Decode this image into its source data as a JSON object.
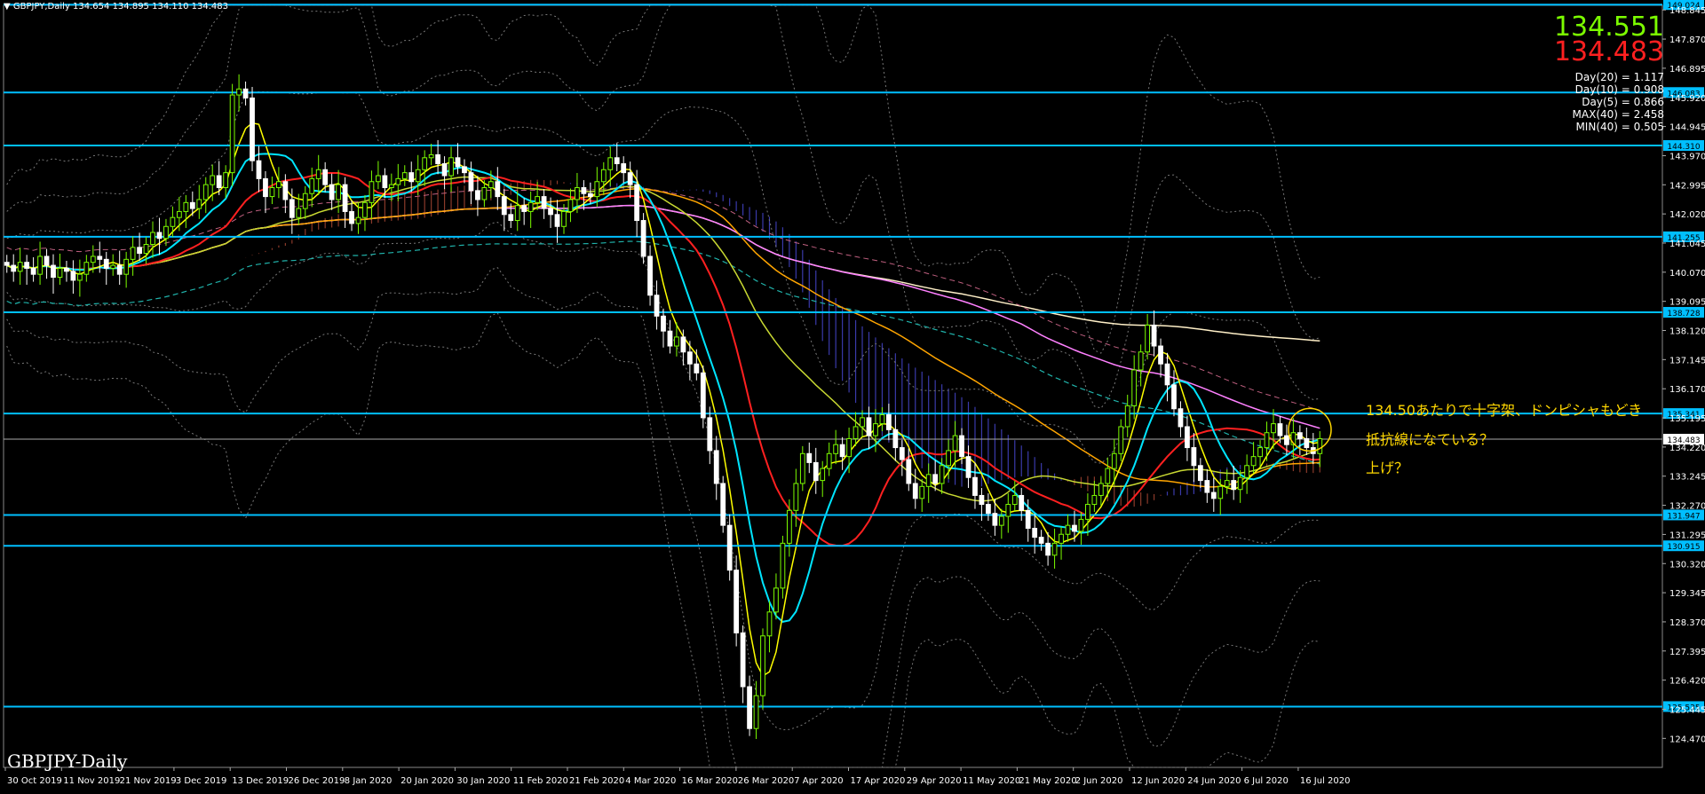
{
  "header": {
    "symbol_line": "▼ GBPJPY,Daily  134.654 134.895 134.110 134.483",
    "bottom_label": "GBPJPY-Daily"
  },
  "hud": {
    "bid": "134.551",
    "ask": "134.483",
    "stats": [
      "Day(20) = 1.117",
      "Day(10) = 0.908",
      "Day(5) = 0.866",
      "MAX(40) = 2.458",
      "MIN(40) = 0.505"
    ]
  },
  "annotations": {
    "line1": "134.50あたりで十字架、ドンピシャもどき",
    "line2": "抵抗線になている？",
    "line3": "上げ？"
  },
  "colors": {
    "background": "#000000",
    "bull_candle": "#7CFC00",
    "bear_candle": "#FFFFFF",
    "hline": "#00BFFF",
    "ma_fast": "#FFFF00",
    "ma_mid": "#00E5FF",
    "ma_red": "#FF2020",
    "ma_slow_yellow": "#C8D832",
    "ma_orange": "#FFA500",
    "ma_pink": "#FF80FF",
    "ma_white": "#FFF0C8",
    "ma_teal": "#20B2AA",
    "cloud_bull": "#8B3A2A",
    "cloud_bear": "#3A3AAA",
    "annotation": "#FFD700"
  },
  "chart_data": {
    "type": "candlestick",
    "symbol": "GBPJPY",
    "timeframe": "Daily",
    "ylim": [
      123.5,
      149.0
    ],
    "y_ticks": [
      "148.845",
      "147.870",
      "146.895",
      "145.920",
      "144.945",
      "143.970",
      "142.995",
      "142.020",
      "141.045",
      "140.070",
      "139.095",
      "138.120",
      "137.145",
      "136.170",
      "135.195",
      "134.220",
      "133.245",
      "132.270",
      "131.295",
      "130.320",
      "129.345",
      "128.370",
      "127.395",
      "126.420",
      "125.445",
      "124.470"
    ],
    "x_ticks": [
      "30 Oct 2019",
      "11 Nov 2019",
      "21 Nov 2019",
      "3 Dec 2019",
      "13 Dec 2019",
      "26 Dec 2019",
      "8 Jan 2020",
      "20 Jan 2020",
      "30 Jan 2020",
      "11 Feb 2020",
      "21 Feb 2020",
      "4 Mar 2020",
      "16 Mar 2020",
      "26 Mar 2020",
      "7 Apr 2020",
      "17 Apr 2020",
      "29 Apr 2020",
      "11 May 2020",
      "21 May 2020",
      "2 Jun 2020",
      "12 Jun 2020",
      "24 Jun 2020",
      "6 Jul 2020",
      "16 Jul 2020"
    ],
    "current_price": 134.483,
    "horizontal_levels": [
      {
        "price": 149.024,
        "label": "149.024"
      },
      {
        "price": 146.083,
        "label": "146.083"
      },
      {
        "price": 144.31,
        "label": "144.310"
      },
      {
        "price": 141.255,
        "label": "141.255"
      },
      {
        "price": 138.728,
        "label": "138.728"
      },
      {
        "price": 135.341,
        "label": "135.341"
      },
      {
        "price": 131.947,
        "label": "131.947"
      },
      {
        "price": 130.915,
        "label": "130.915"
      },
      {
        "price": 125.535,
        "label": "125.535"
      }
    ],
    "close_series": [
      140.3,
      140.1,
      140.4,
      140.2,
      140.0,
      140.6,
      140.3,
      139.9,
      140.2,
      140.1,
      139.8,
      140.0,
      140.4,
      140.6,
      140.5,
      140.2,
      140.3,
      140.0,
      140.5,
      140.9,
      140.7,
      141.0,
      141.4,
      141.2,
      141.6,
      141.9,
      142.1,
      142.4,
      142.2,
      142.5,
      143.0,
      143.3,
      142.9,
      143.4,
      146.0,
      146.2,
      145.9,
      143.8,
      143.2,
      142.6,
      142.9,
      143.1,
      142.5,
      141.9,
      142.2,
      142.7,
      143.2,
      143.5,
      143.0,
      142.5,
      143.0,
      142.1,
      141.7,
      141.9,
      142.4,
      143.1,
      143.3,
      142.9,
      143.0,
      143.2,
      143.4,
      143.1,
      143.5,
      143.9,
      144.0,
      143.7,
      143.3,
      143.9,
      143.6,
      143.4,
      142.8,
      142.5,
      142.9,
      143.1,
      142.6,
      142.0,
      141.8,
      142.3,
      142.1,
      142.4,
      142.6,
      142.2,
      142.0,
      141.6,
      142.1,
      142.5,
      142.9,
      142.7,
      142.6,
      143.1,
      143.5,
      143.9,
      143.7,
      143.4,
      143.0,
      141.8,
      140.6,
      139.3,
      138.6,
      138.1,
      137.6,
      137.9,
      137.4,
      137.0,
      136.7,
      135.2,
      134.1,
      133.0,
      131.6,
      130.1,
      128.0,
      126.2,
      124.8,
      125.9,
      127.9,
      128.7,
      129.5,
      131.0,
      132.1,
      133.0,
      134.0,
      133.7,
      133.1,
      133.5,
      134.0,
      134.3,
      133.9,
      134.5,
      134.9,
      135.2,
      134.6,
      135.0,
      135.3,
      134.8,
      134.2,
      133.8,
      133.0,
      132.5,
      132.9,
      133.3,
      133.0,
      133.6,
      134.1,
      134.6,
      133.9,
      133.2,
      132.6,
      132.3,
      132.0,
      131.6,
      131.9,
      132.3,
      132.6,
      132.1,
      131.5,
      131.2,
      131.0,
      130.6,
      131.0,
      131.3,
      131.6,
      131.4,
      131.8,
      132.3,
      132.6,
      133.0,
      133.5,
      134.0,
      134.9,
      135.6,
      136.8,
      137.4,
      138.3,
      137.6,
      137.0,
      136.3,
      135.5,
      134.9,
      134.2,
      133.6,
      133.1,
      132.7,
      132.5,
      132.9,
      133.1,
      132.8,
      133.2,
      133.6,
      133.9,
      134.2,
      134.7,
      135.0,
      134.6,
      134.3,
      134.7,
      134.5,
      134.2,
      134.0,
      134.5
    ]
  }
}
